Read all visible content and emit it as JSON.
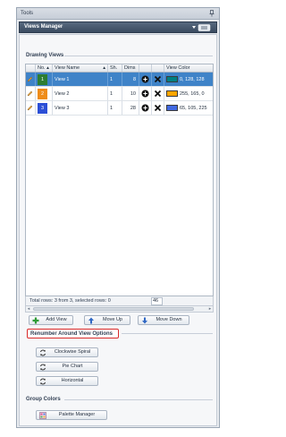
{
  "window": {
    "title": "Tools"
  },
  "panel": {
    "title": "Views Manager"
  },
  "drawing_views": {
    "section_title": "Drawing Views",
    "columns": [
      "No.",
      "View Name",
      "Sh.",
      "Dims",
      "View Color"
    ],
    "rows": [
      {
        "no": "1",
        "name": "View 1",
        "sheet": "1",
        "dims": "8",
        "color_text": "0, 128, 128",
        "color": "#008080",
        "selected": true
      },
      {
        "no": "2",
        "name": "View 2",
        "sheet": "1",
        "dims": "10",
        "color_text": "255, 165, 0",
        "color": "#ffa500",
        "selected": false
      },
      {
        "no": "3",
        "name": "View 3",
        "sheet": "1",
        "dims": "28",
        "color_text": "65, 105, 225",
        "color": "#4169e1",
        "selected": false
      }
    ],
    "status_text": "Total rows: 3 from 3, selected rows: 0",
    "status_value": "46"
  },
  "view_buttons": {
    "add": "Add View",
    "move_up": "Move Up",
    "move_down": "Move Down"
  },
  "renumber": {
    "section_title": "Renumber Around View Options",
    "buttons": [
      "Clockwise Spiral",
      "Pie Chart",
      "Horizontal"
    ]
  },
  "group_colors": {
    "section_title": "Group Colors",
    "palette_button": "Palette Manager"
  },
  "colors": {
    "selection": "#3f83c8",
    "header": "#3a4b60",
    "highlight": "#d92a2a",
    "row1_number_bg": "#2e7d32",
    "row2_number_bg": "#ef8c1a",
    "row3_number_bg": "#2c4fd6"
  }
}
